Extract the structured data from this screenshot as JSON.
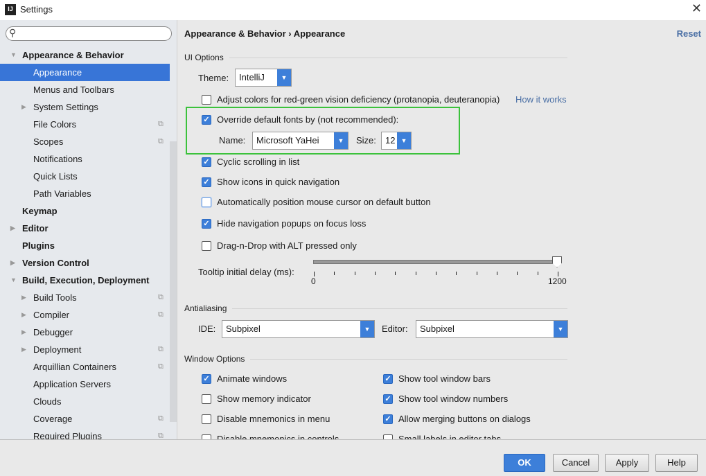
{
  "window": {
    "title": "Settings",
    "logo": "IJ",
    "close_icon": "close-icon"
  },
  "search": {
    "value": "",
    "placeholder": ""
  },
  "sidebar": {
    "items": [
      {
        "label": "Appearance & Behavior",
        "level": 0,
        "bold": true,
        "arrow": "down"
      },
      {
        "label": "Appearance",
        "level": 1,
        "selected": true
      },
      {
        "label": "Menus and Toolbars",
        "level": 1
      },
      {
        "label": "System Settings",
        "level": 1,
        "arrow": "right"
      },
      {
        "label": "File Colors",
        "level": 1,
        "project": true
      },
      {
        "label": "Scopes",
        "level": 1,
        "project": true
      },
      {
        "label": "Notifications",
        "level": 1
      },
      {
        "label": "Quick Lists",
        "level": 1
      },
      {
        "label": "Path Variables",
        "level": 1
      },
      {
        "label": "Keymap",
        "level": 0,
        "bold": true
      },
      {
        "label": "Editor",
        "level": 0,
        "bold": true,
        "arrow": "right"
      },
      {
        "label": "Plugins",
        "level": 0,
        "bold": true
      },
      {
        "label": "Version Control",
        "level": 0,
        "bold": true,
        "arrow": "right"
      },
      {
        "label": "Build, Execution, Deployment",
        "level": 0,
        "bold": true,
        "arrow": "down"
      },
      {
        "label": "Build Tools",
        "level": 1,
        "arrow": "right",
        "project": true
      },
      {
        "label": "Compiler",
        "level": 1,
        "arrow": "right",
        "project": true
      },
      {
        "label": "Debugger",
        "level": 1,
        "arrow": "right"
      },
      {
        "label": "Deployment",
        "level": 1,
        "arrow": "right",
        "project": true
      },
      {
        "label": "Arquillian Containers",
        "level": 1,
        "project": true
      },
      {
        "label": "Application Servers",
        "level": 1
      },
      {
        "label": "Clouds",
        "level": 1
      },
      {
        "label": "Coverage",
        "level": 1,
        "project": true
      },
      {
        "label": "Required Plugins",
        "level": 1,
        "project": true
      }
    ]
  },
  "header": {
    "breadcrumb_parent": "Appearance & Behavior",
    "separator": "›",
    "breadcrumb_current": "Appearance",
    "reset": "Reset"
  },
  "ui_options": {
    "section": "UI Options",
    "theme_label": "Theme:",
    "theme_value": "IntelliJ",
    "adjust_colors": {
      "label": "Adjust colors for red-green vision deficiency (protanopia, deuteranopia)",
      "checked": false
    },
    "how_it_works": "How it works",
    "override_fonts": {
      "label": "Override default fonts by (not recommended):",
      "checked": true
    },
    "name_label": "Name:",
    "name_value": "Microsoft YaHei",
    "size_label": "Size:",
    "size_value": "12",
    "cyclic": {
      "label": "Cyclic scrolling in list",
      "checked": true
    },
    "show_icons": {
      "label": "Show icons in quick navigation",
      "checked": true
    },
    "auto_mouse": {
      "label": "Automatically position mouse cursor on default button",
      "checked": false
    },
    "hide_popups": {
      "label": "Hide navigation popups on focus loss",
      "checked": true
    },
    "dnd_alt": {
      "label": "Drag-n-Drop with ALT pressed only",
      "checked": false
    },
    "tooltip_label": "Tooltip initial delay (ms):",
    "tooltip_min": "0",
    "tooltip_max": "1200",
    "tooltip_value": 1200
  },
  "antialiasing": {
    "section": "Antialiasing",
    "ide_label": "IDE:",
    "ide_value": "Subpixel",
    "editor_label": "Editor:",
    "editor_value": "Subpixel"
  },
  "window_options": {
    "section": "Window Options",
    "items": [
      {
        "label": "Animate windows",
        "checked": true
      },
      {
        "label": "Show tool window bars",
        "checked": true
      },
      {
        "label": "Show memory indicator",
        "checked": false
      },
      {
        "label": "Show tool window numbers",
        "checked": true
      },
      {
        "label": "Disable mnemonics in menu",
        "checked": false
      },
      {
        "label": "Allow merging buttons on dialogs",
        "checked": true
      },
      {
        "label": "Disable mnemonics in controls",
        "checked": false
      },
      {
        "label": "Small labels in editor tabs",
        "checked": false
      }
    ]
  },
  "buttons": {
    "ok": "OK",
    "cancel": "Cancel",
    "apply": "Apply",
    "help": "Help"
  },
  "colors": {
    "accent": "#3875d7",
    "highlight_box": "#3cc23c",
    "link": "#4a6fa5"
  }
}
